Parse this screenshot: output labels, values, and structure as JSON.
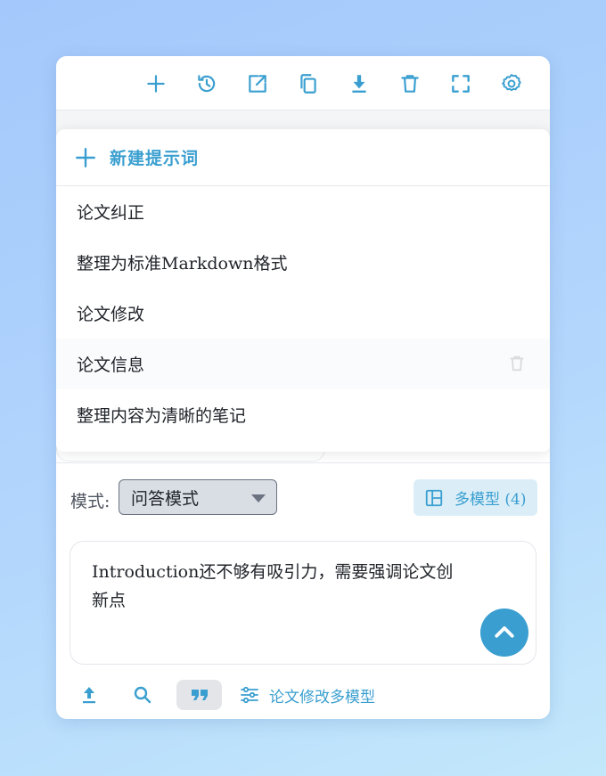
{
  "colors": {
    "accent": "#3a9fd0",
    "text": "#1f2329",
    "muted": "#505761",
    "select_bg": "#d9dee5",
    "chip_bg": "#dbeef8"
  },
  "toolbar": {
    "icons": [
      "plus-icon",
      "history-icon",
      "open-external-icon",
      "copy-icon",
      "download-icon",
      "delete-icon",
      "fullscreen-icon",
      "settings-icon"
    ]
  },
  "prompt_menu": {
    "new_label": "新建提示词",
    "items": [
      "论文纠正",
      "整理为标准Markdown格式",
      "论文修改",
      "论文信息",
      "整理内容为清晰的笔记"
    ]
  },
  "mode": {
    "label": "模式:",
    "selected": "问答模式"
  },
  "multi_model": {
    "label": "多模型 (4)"
  },
  "input": {
    "value": "Introduction还不够有吸引力，需要强调论文创新点"
  },
  "bottom_bar": {
    "preset_label": "论文修改多模型"
  }
}
